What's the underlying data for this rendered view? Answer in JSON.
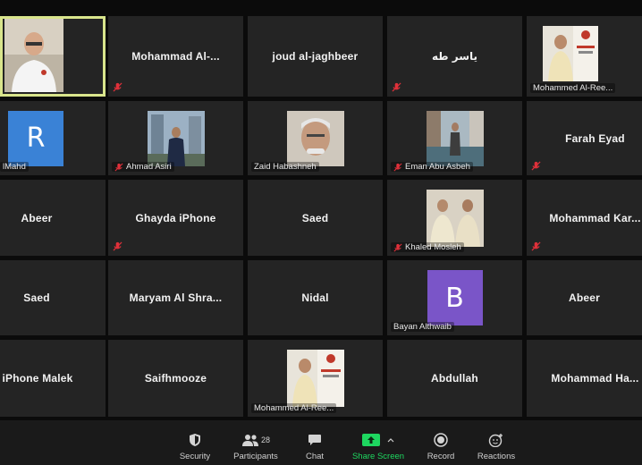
{
  "tiles": {
    "t1": {
      "name": ""
    },
    "t2": {
      "name": "Mohammad  Al-..."
    },
    "t3": {
      "name": "joud al-jaghbeer"
    },
    "t4": {
      "name": "ياسر طه"
    },
    "t5": {
      "name": "Mohammed Al-Ree..."
    },
    "t6": {
      "name": "lMahd",
      "avatar_letter": "R",
      "avatar_color": "#3a82d6"
    },
    "t7": {
      "name": "Ahmad Asiri"
    },
    "t8": {
      "name": "Zaid Habashneh"
    },
    "t9": {
      "name": "Eman Abu Asbeh"
    },
    "t10": {
      "name": "Farah Eyad"
    },
    "t11": {
      "name": "Abeer"
    },
    "t12": {
      "name": "Ghayda iPhone"
    },
    "t13": {
      "name": "Saed"
    },
    "t14": {
      "name": "Khaled Mosleh"
    },
    "t15": {
      "name": "Mohammad  Kar..."
    },
    "t16": {
      "name": "Saed"
    },
    "t17": {
      "name": "Maryam  Al Shra..."
    },
    "t18": {
      "name": "Nidal"
    },
    "t19": {
      "name": "Bayan Althwaib",
      "avatar_letter": "B",
      "avatar_color": "#7a55c8"
    },
    "t20": {
      "name": "Abeer"
    },
    "t21": {
      "name": "iPhone Malek"
    },
    "t22": {
      "name": "Saifhmooze"
    },
    "t23": {
      "name": "Mohammed Al-Ree..."
    },
    "t24": {
      "name": "Abdullah"
    },
    "t25": {
      "name": "Mohammad  Ha..."
    }
  },
  "toolbar": {
    "security": "Security",
    "participants": "Participants",
    "participants_count": "28",
    "chat": "Chat",
    "share_screen": "Share Screen",
    "record": "Record",
    "reactions": "Reactions"
  },
  "colors": {
    "active_border": "#d9e58c",
    "share_green": "#1ed760",
    "mute_red": "#e0303a"
  }
}
